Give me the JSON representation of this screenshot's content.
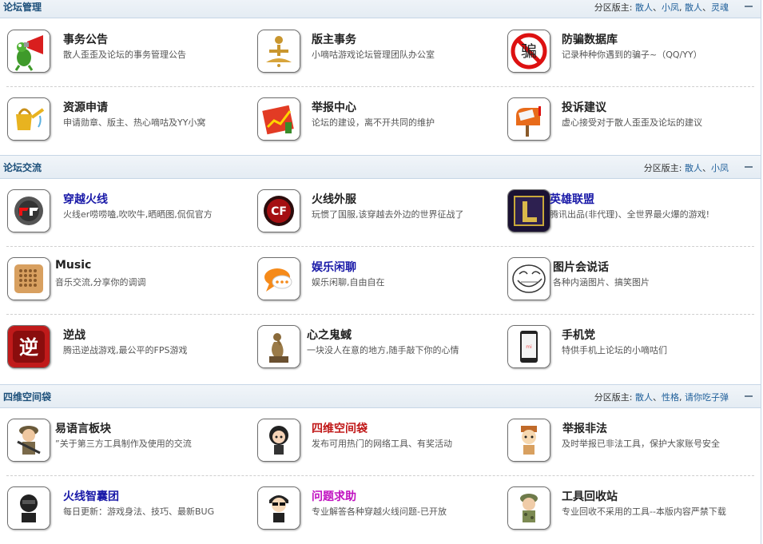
{
  "sections": [
    {
      "title": "论坛管理",
      "moderators_label": "分区版主:",
      "moderators": [
        {
          "name": "散人",
          "sep": "、"
        },
        {
          "name": "小凤",
          "sep": ", "
        },
        {
          "name": "散人",
          "sep": "、"
        },
        {
          "name": "灵魂",
          "sep": ""
        }
      ],
      "forums": [
        {
          "name": "事务公告",
          "desc": "散人歪歪及论坛的事务管理公告",
          "icon": "megaphone-frog-icon",
          "color": "#222222"
        },
        {
          "name": "版主事务",
          "desc": "小嘀咕游戏论坛管理团队办公室",
          "icon": "meditating-figure-icon",
          "color": "#222222"
        },
        {
          "name": "防骗数据库",
          "desc": "记录种种你遇到的骗子~（QQ/YY）",
          "icon": "no-fraud-sign-icon",
          "color": "#222222"
        },
        {
          "name": "资源申请",
          "desc": "申请勋章、版主、热心嘀咕及YY小窝",
          "icon": "watering-can-icon",
          "color": "#222222"
        },
        {
          "name": "举报中心",
          "desc": "论坛的建设，离不开共同的维护",
          "icon": "report-chart-icon",
          "color": "#222222"
        },
        {
          "name": "投诉建议",
          "desc": "虚心接受对于散人歪歪及论坛的建议",
          "icon": "mailbox-icon",
          "color": "#222222"
        }
      ]
    },
    {
      "title": "论坛交流",
      "moderators_label": "分区版主:",
      "moderators": [
        {
          "name": "散人",
          "sep": "、"
        },
        {
          "name": "小凤",
          "sep": ""
        }
      ],
      "forums": [
        {
          "name": "穿越火线",
          "desc": "火线er唠唠嗑,吹吹牛,晒晒图,侃侃官方",
          "icon": "crossfire-logo-icon",
          "color": "#1a1aa8"
        },
        {
          "name": "火线外服",
          "desc": "玩惯了国服,该穿越去外边的世界征战了",
          "icon": "crossfire-global-logo-icon",
          "color": "#222222"
        },
        {
          "name": "英雄联盟",
          "desc": "腾讯出品(非代理)、全世界最火爆的游戏!",
          "icon": "league-of-legends-logo-icon",
          "color": "#1a1aa8"
        },
        {
          "name": "Music",
          "desc": "音乐交流,分享你的调调",
          "icon": "speaker-icon",
          "color": "#222222"
        },
        {
          "name": "娱乐闲聊",
          "desc": "娱乐闲聊,自由自在",
          "icon": "chat-bubble-icon",
          "color": "#1a1aa8"
        },
        {
          "name": "图片会说话",
          "desc": "各种内涵图片、搞笑图片",
          "icon": "troll-face-icon",
          "color": "#222222"
        },
        {
          "name": "逆战",
          "desc": "腾迅逆战游戏,最公平的FPS游戏",
          "icon": "nizhan-logo-icon",
          "color": "#222222"
        },
        {
          "name": "心之鬼蜮",
          "desc": "一块没人在意的地方,随手敲下你的心情",
          "icon": "thinker-statue-icon",
          "color": "#222222"
        },
        {
          "name": "手机党",
          "desc": "特供手机上论坛的小嘀咕们",
          "icon": "smartphone-icon",
          "color": "#222222"
        }
      ]
    },
    {
      "title": "四维空间袋",
      "moderators_label": "分区版主:",
      "moderators": [
        {
          "name": "散人",
          "sep": "、"
        },
        {
          "name": "性格",
          "sep": ", "
        },
        {
          "name": "请你吃子弹",
          "sep": ""
        }
      ],
      "forums": [
        {
          "name": "易语言板块",
          "desc": "”关于第三方工具制作及使用的交流",
          "icon": "soldier-avatar-icon",
          "color": "#222222"
        },
        {
          "name": "四维空间袋",
          "desc": "发布可用热门的网络工具、有奖活动",
          "icon": "girl-avatar-icon",
          "color": "#c01818"
        },
        {
          "name": "举报非法",
          "desc": "及时举报已非法工具，保护大家账号安全",
          "icon": "officer-avatar-icon",
          "color": "#222222"
        },
        {
          "name": "火线智囊团",
          "desc": "每日更新：游戏身法、技巧、最新BUG",
          "icon": "masked-avatar-icon",
          "color": "#1a1aa8"
        },
        {
          "name": "问题求助",
          "desc": "专业解答各种穿越火线问题-已开放",
          "icon": "sunglasses-avatar-icon",
          "color": "#c010c0"
        },
        {
          "name": "工具回收站",
          "desc": "专业回收不采用的工具--本版内容严禁下载",
          "icon": "camo-avatar-icon",
          "color": "#222222"
        }
      ]
    }
  ]
}
